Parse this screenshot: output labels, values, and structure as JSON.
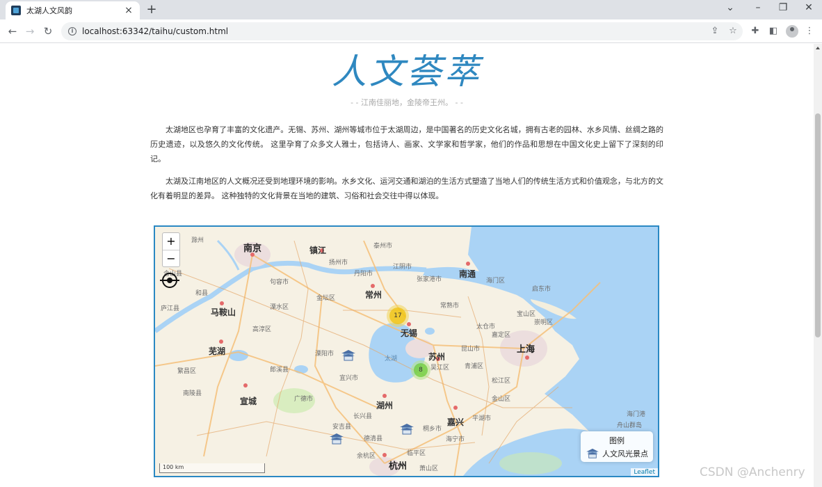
{
  "browser": {
    "tab_title": "太湖人文风韵",
    "url": "localhost:63342/taihu/custom.html",
    "tab_close": "×",
    "new_tab": "+",
    "win_min": "⌄",
    "win_minimize": "–",
    "win_restore": "❐",
    "win_close": "✕"
  },
  "page": {
    "heading": "人文荟萃",
    "subtitle": "- - 江南佳丽地，金陵帝王州。 - -",
    "paragraphs": [
      "太湖地区也孕育了丰富的文化遗产。无锡、苏州、湖州等城市位于太湖周边，是中国著名的历史文化名城，拥有古老的园林、水乡风情、丝绸之路的历史遗迹，以及悠久的文化传统。 这里孕育了众多文人雅士，包括诗人、画家、文学家和哲学家，他们的作品和思想在中国文化史上留下了深刻的印记。",
      "太湖及江南地区的人文概况还受到地理环境的影响。水乡文化、运河交通和湖泊的生活方式塑造了当地人们的传统生活方式和价值观念，与北方的文化有着明显的差异。 这种独特的文化背景在当地的建筑、习俗和社会交往中得以体现。"
    ]
  },
  "map": {
    "zoom_in": "+",
    "zoom_out": "−",
    "clusters": [
      {
        "label": "17"
      },
      {
        "label": "8"
      }
    ],
    "legend_title": "图例",
    "legend_item": "人文风光景点",
    "scale": "100 km",
    "attribution": "Leaflet",
    "labels": {
      "nanjing": "南京",
      "zhenjiang": "镇江",
      "changzhou": "常州",
      "wuxi": "无锡",
      "suzhou": "苏州",
      "shanghai": "上海",
      "nantong": "南通",
      "huzhou": "湖州",
      "hangzhou": "杭州",
      "jiaxing": "嘉兴",
      "wuhu": "芜湖",
      "xuancheng": "宣城",
      "maanshan": "马鞍山",
      "taihu": "太湖",
      "chuzhou": "滁州",
      "yangzhou": "扬州市",
      "taizhou": "泰州市",
      "jiangyin": "江阴市",
      "zhangjiagang": "张家港市",
      "changshu": "常熟市",
      "kunshan": "昆山市",
      "taicang": "太仓市",
      "qidong": "启东市",
      "haimen": "海门区",
      "liyang": "溧阳市",
      "yixing": "宜兴市",
      "jintan": "金坛区",
      "danyang": "丹阳市",
      "jurong": "句容市",
      "gaochun": "高淳区",
      "lishui": "溧水区",
      "changxing": "长兴县",
      "anji": "安吉县",
      "deqing": "德清县",
      "tongxiang": "桐乡市",
      "haining": "海宁市",
      "pinghu": "平湖市",
      "jinshan": "金山区",
      "songjiang": "松江区",
      "qingpu": "青浦区",
      "jiading": "嘉定区",
      "baoshan": "宝山区",
      "chongming": "崇明区",
      "wujiang": "吴江区",
      "langxi": "郎溪县",
      "guangde": "广德市",
      "hexian": "和县",
      "hanshan": "含山县",
      "lujiang": "庐江县",
      "fanchang": "繁昌区",
      "nanling": "南陵县",
      "yuhang": "余杭区",
      "linping": "临平区",
      "xiaoshan": "萧山区",
      "zhoushan": "舟山群岛",
      "hudong": "海门港"
    }
  },
  "watermark": "CSDN @Anchenry"
}
